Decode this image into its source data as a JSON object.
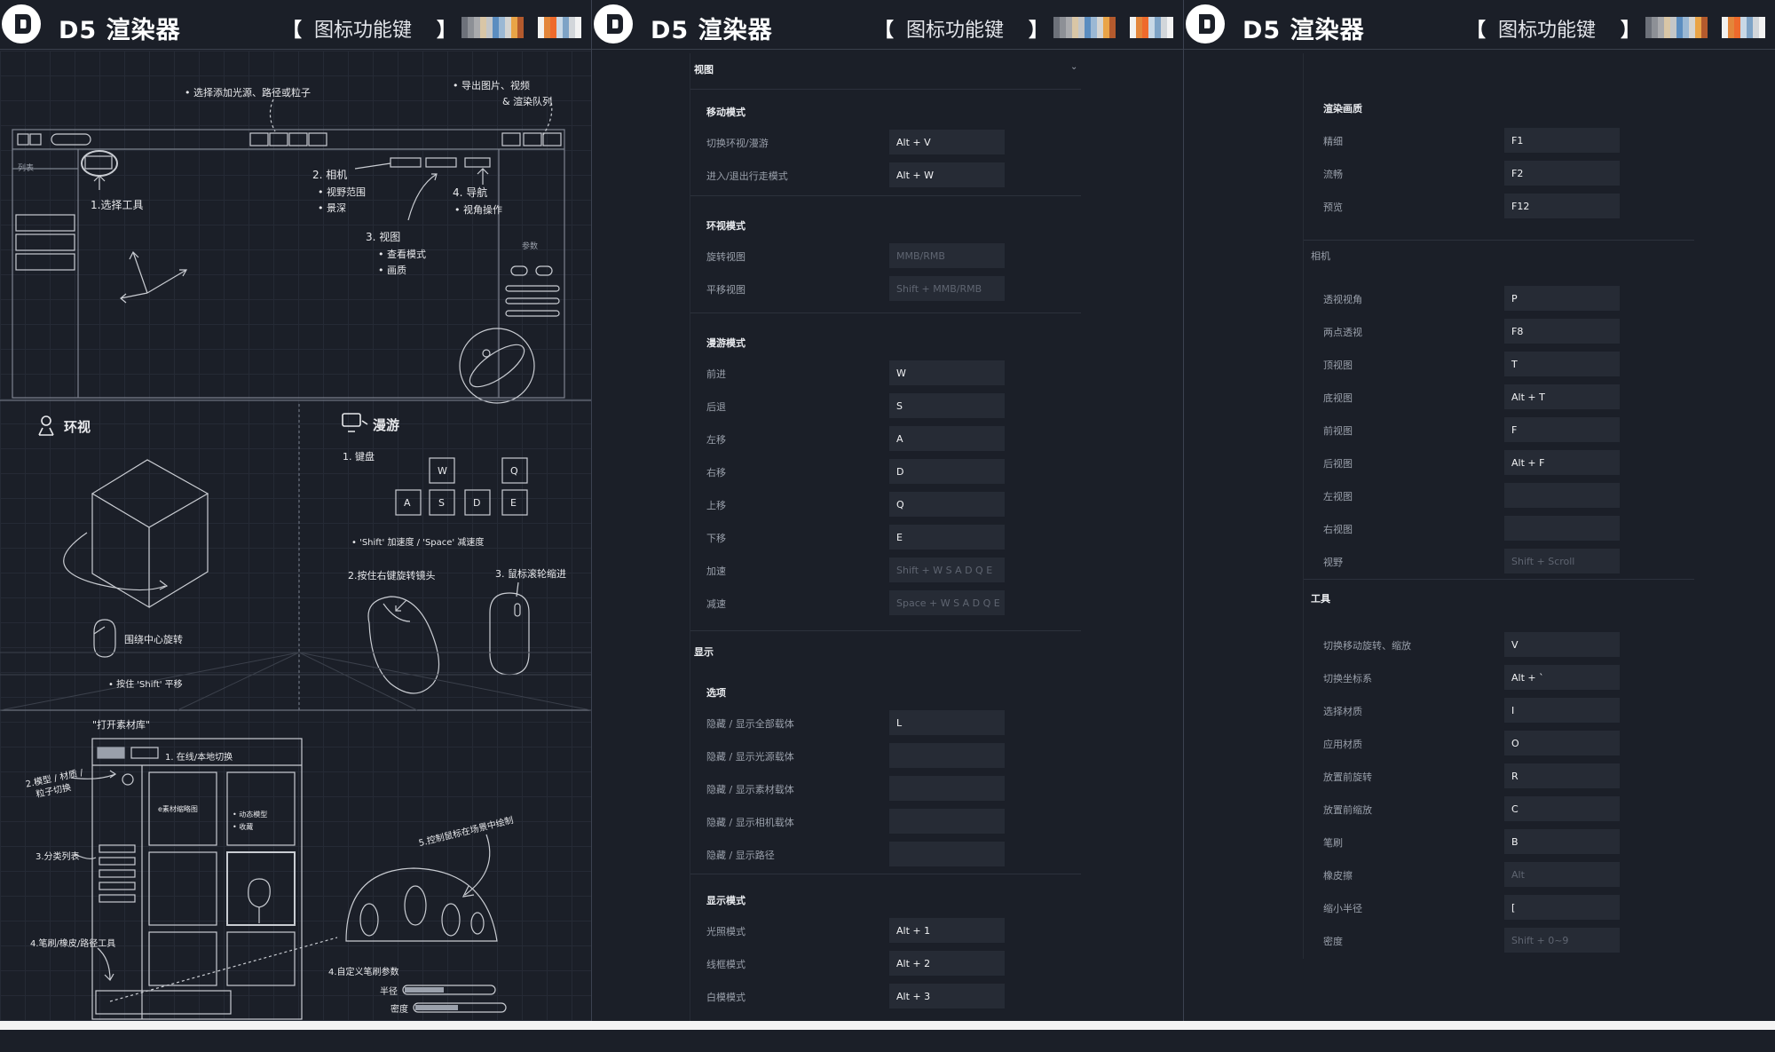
{
  "header": {
    "brand": "D5 渲染器",
    "bracket_open": "【",
    "title": "图标功能键",
    "bracket_close": "】",
    "swatch_a": [
      "#6d717a",
      "#8d9096",
      "#a9aaad",
      "#d9c6a6",
      "#c4c6c8",
      "#5b8dc0",
      "#9bb8d4",
      "#d4d4d2",
      "#e9a447",
      "#b45a2d"
    ],
    "swatch_b": [
      "#f2f2f0",
      "#e3863a",
      "#ee6a2c",
      "#c8d8e6",
      "#7ea3c6",
      "#d2d6da",
      "#f2f2f2"
    ]
  },
  "panel1": {
    "top_notes": {
      "add_light": "• 选择添加光源、路径或粒子",
      "export": "• 导出图片、视频",
      "render_queue": "& 渲染队列",
      "list": "列表",
      "select_tool": "1.选择工具",
      "camera": "2. 相机",
      "camera_a": "• 视野范围",
      "camera_b": "• 景深",
      "view": "3. 视图",
      "view_a": "• 查看模式",
      "view_b": "• 画质",
      "nav": "4. 导航",
      "nav_a": "• 视角操作",
      "params": "参数"
    },
    "orbit": {
      "title": "环视",
      "mouse_note": "围绕中心旋转",
      "shift_note": "• 按住 'Shift' 平移"
    },
    "roam": {
      "title": "漫游",
      "keyboard": "1. 键盘",
      "keys": [
        "W",
        "Q",
        "A",
        "S",
        "D",
        "E"
      ],
      "speed_note": "• 'Shift' 加速度 / 'Space' 减速度",
      "right_drag": "2.按住右键旋转镜头",
      "scroll": "3. 鼠标滚轮缩进"
    },
    "material": {
      "open_lib": "\"打开素材库\"",
      "online_local": "1. 在线/本地切换",
      "type_switch_1": "2.模型 / 材质 /",
      "type_switch_2": "粒子切换",
      "category": "3.分类列表",
      "brush_tools": "4.笔刷/橡皮/路径工具",
      "scene_draw": "5.控制鼠标在场景中绘制",
      "brush_params": "4.自定义笔刷参数",
      "radius": "半径",
      "density": "密度",
      "thumb_text": "e素材缩略图",
      "dyn_a": "• 动态模型",
      "dyn_b": "• 收藏"
    }
  },
  "panel2": {
    "view_section": "视图",
    "move_mode": "移动模式",
    "move_rows": [
      {
        "label": "切换环视/漫游",
        "key": "Alt + V"
      },
      {
        "label": "进入/退出行走模式",
        "key": "Alt + W"
      }
    ],
    "orbit_mode": "环视模式",
    "orbit_rows": [
      {
        "label": "旋转视图",
        "key": "MMB/RMB"
      },
      {
        "label": "平移视图",
        "key": "Shift + MMB/RMB"
      }
    ],
    "roam_mode": "漫游模式",
    "roam_rows": [
      {
        "label": "前进",
        "key": "W"
      },
      {
        "label": "后退",
        "key": "S"
      },
      {
        "label": "左移",
        "key": "A"
      },
      {
        "label": "右移",
        "key": "D"
      },
      {
        "label": "上移",
        "key": "Q"
      },
      {
        "label": "下移",
        "key": "E"
      },
      {
        "label": "加速",
        "key": "Shift + W S A D Q E"
      },
      {
        "label": "减速",
        "key": "Space + W S A D Q E"
      }
    ],
    "display_section": "显示",
    "options": "选项",
    "option_rows": [
      {
        "label": "隐藏 / 显示全部载体",
        "key": "L"
      },
      {
        "label": "隐藏 / 显示光源载体",
        "key": ""
      },
      {
        "label": "隐藏 / 显示素材载体",
        "key": ""
      },
      {
        "label": "隐藏 / 显示相机载体",
        "key": ""
      },
      {
        "label": "隐藏 / 显示路径",
        "key": ""
      }
    ],
    "display_mode": "显示模式",
    "display_rows": [
      {
        "label": "光照模式",
        "key": "Alt + 1"
      },
      {
        "label": "线框模式",
        "key": "Alt + 2"
      },
      {
        "label": "白模模式",
        "key": "Alt + 3"
      }
    ]
  },
  "panel3": {
    "render_quality": "渲染画质",
    "quality_rows": [
      {
        "label": "精细",
        "key": "F1"
      },
      {
        "label": "流畅",
        "key": "F2"
      },
      {
        "label": "预览",
        "key": "F12"
      }
    ],
    "camera": "相机",
    "camera_rows": [
      {
        "label": "透视视角",
        "key": "P"
      },
      {
        "label": "两点透视",
        "key": "F8"
      },
      {
        "label": "顶视图",
        "key": "T"
      },
      {
        "label": "底视图",
        "key": "Alt + T"
      },
      {
        "label": "前视图",
        "key": "F"
      },
      {
        "label": "后视图",
        "key": "Alt + F"
      },
      {
        "label": "左视图",
        "key": ""
      },
      {
        "label": "右视图",
        "key": ""
      },
      {
        "label": "视野",
        "key": "Shift + Scroll"
      }
    ],
    "tools": "工具",
    "tool_rows": [
      {
        "label": "切换移动旋转、缩放",
        "key": "V"
      },
      {
        "label": "切换坐标系",
        "key": "Alt + `"
      },
      {
        "label": "选择材质",
        "key": "I"
      },
      {
        "label": "应用材质",
        "key": "O"
      },
      {
        "label": "放置前旋转",
        "key": "R"
      },
      {
        "label": "放置前缩放",
        "key": "C"
      },
      {
        "label": "笔刷",
        "key": "B"
      },
      {
        "label": "橡皮擦",
        "key": "Alt"
      },
      {
        "label": "缩小半径",
        "key": "["
      },
      {
        "label": "密度",
        "key": "Shift + 0~9"
      }
    ]
  }
}
